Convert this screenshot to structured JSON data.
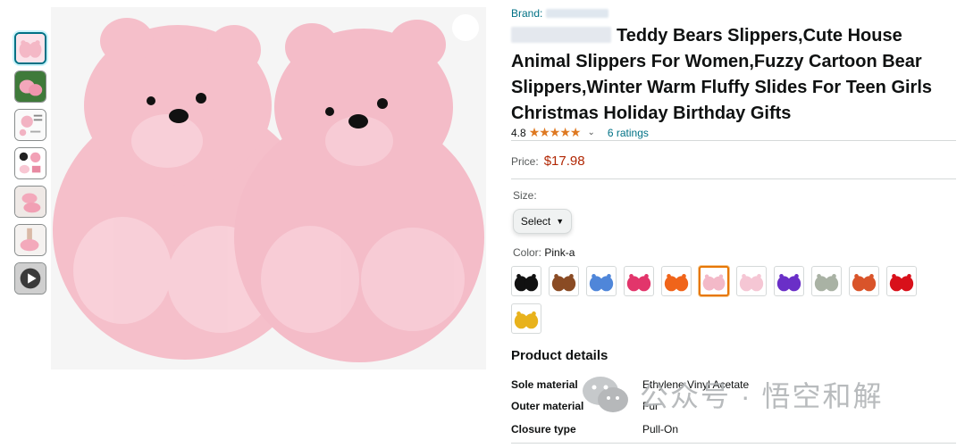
{
  "thumbnails": [
    {
      "name": "thumb-pink-bears",
      "active": true
    },
    {
      "name": "thumb-green-bears",
      "active": false
    },
    {
      "name": "thumb-size-chart",
      "active": false
    },
    {
      "name": "thumb-detail-grid",
      "active": false
    },
    {
      "name": "thumb-worn-slippers",
      "active": false
    },
    {
      "name": "thumb-feet-slippers",
      "active": false
    },
    {
      "name": "thumb-video",
      "active": false
    }
  ],
  "product": {
    "brand_label": "Brand:",
    "title": "Teddy Bears Slippers,Cute House Animal Slippers For Women,Fuzzy Cartoon Bear Slippers,Winter Warm Fluffy Slides For Teen Girls Christmas Holiday Birthday Gifts",
    "rating_value": "4.8",
    "stars": "★★★★★",
    "ratings_count": "6 ratings",
    "price_label": "Price:",
    "price": "$17.98",
    "size_label": "Size:",
    "size_select": "Select",
    "color_label": "Color:",
    "color_value": "Pink-a"
  },
  "swatches": [
    {
      "color": "#111111",
      "name": "black"
    },
    {
      "color": "#8a4b24",
      "name": "brown"
    },
    {
      "color": "#4f86d9",
      "name": "blue"
    },
    {
      "color": "#e2356b",
      "name": "rose"
    },
    {
      "color": "#f0641a",
      "name": "orange"
    },
    {
      "color": "#f3b9c8",
      "name": "pink-a",
      "selected": true
    },
    {
      "color": "#f5c6d4",
      "name": "light-pink"
    },
    {
      "color": "#6a2fc7",
      "name": "purple"
    },
    {
      "color": "#a9b2a4",
      "name": "grey-green"
    },
    {
      "color": "#d9542a",
      "name": "multicolor"
    },
    {
      "color": "#d8101a",
      "name": "red"
    },
    {
      "color": "#e8b21c",
      "name": "yellow"
    }
  ],
  "details": {
    "heading": "Product details",
    "rows": [
      {
        "key": "Sole material",
        "value": "Ethylene Vinyl Acetate"
      },
      {
        "key": "Outer material",
        "value": "Fur"
      },
      {
        "key": "Closure type",
        "value": "Pull-On"
      }
    ]
  },
  "watermark": {
    "text": "公众号 · 悟空和解"
  },
  "colors": {
    "link": "#007185",
    "price": "#b12704",
    "star": "#de7921",
    "selected_border": "#e77600"
  }
}
